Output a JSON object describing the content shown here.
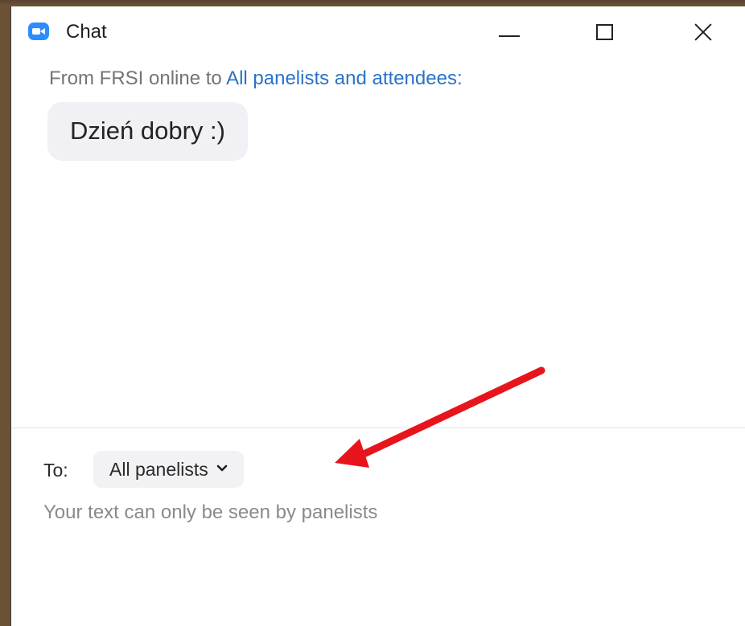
{
  "window": {
    "title": "Chat"
  },
  "message": {
    "prefix": "From FRSI online to ",
    "recipient": "All panelists and attendees:",
    "text": "Dzień dobry :)"
  },
  "compose": {
    "to_label": "To:",
    "to_value": "All panelists",
    "hint": "Your text can only be seen by panelists"
  },
  "colors": {
    "accent": "#2d8cff",
    "recipient_link": "#2a72c8",
    "annotation_arrow": "#e8141c"
  },
  "icons": {
    "app": "zoom-camera-icon",
    "minimize": "minimize-icon",
    "maximize": "maximize-icon",
    "close": "close-icon",
    "dropdown": "chevron-down-icon"
  }
}
